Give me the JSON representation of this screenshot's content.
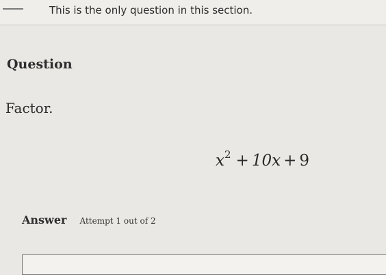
{
  "banner": {
    "text": "This is the only question in this section."
  },
  "question": {
    "heading": "Question",
    "prompt": "Factor.",
    "expression": {
      "base": "x",
      "exponent": "2",
      "op1": "+",
      "middle": "10x",
      "op2": "+",
      "constant": "9"
    }
  },
  "answer": {
    "label": "Answer",
    "attempt_text": "Attempt 1 out of 2",
    "input_value": ""
  }
}
